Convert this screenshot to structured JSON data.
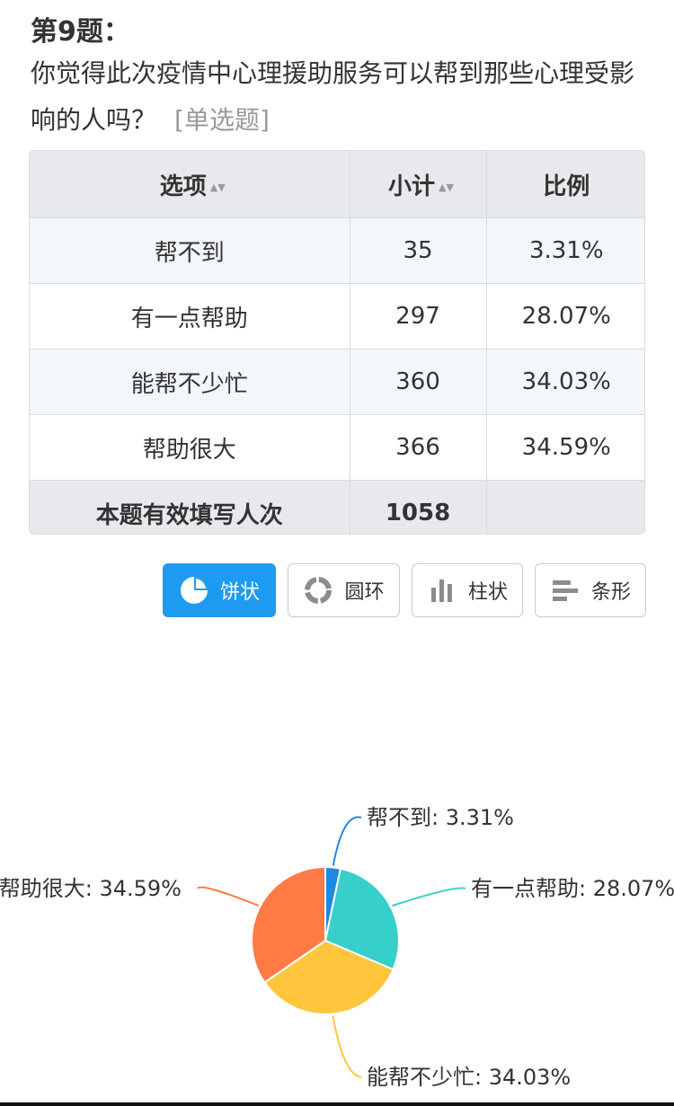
{
  "question": {
    "number": "第9题：",
    "text": "你觉得此次疫情中心理援助服务可以帮到那些心理受影响的人吗？",
    "type": "[单选题]"
  },
  "table": {
    "headers": [
      "选项",
      "小计",
      "比例"
    ],
    "rows": [
      {
        "option": "帮不到",
        "count": "35",
        "ratio": "3.31%"
      },
      {
        "option": "有一点帮助",
        "count": "297",
        "ratio": "28.07%"
      },
      {
        "option": "能帮不少忙",
        "count": "360",
        "ratio": "34.03%"
      },
      {
        "option": "帮助很大",
        "count": "366",
        "ratio": "34.59%"
      }
    ],
    "total_label": "本题有效填写人次",
    "total_value": "1058",
    "total_ratio": ""
  },
  "chart_buttons": [
    {
      "label": "饼状",
      "icon": "pie-chart-icon",
      "active": true
    },
    {
      "label": "圆环",
      "icon": "donut-chart-icon",
      "active": false
    },
    {
      "label": "柱状",
      "icon": "bar-chart-icon",
      "active": false
    },
    {
      "label": "条形",
      "icon": "horizontal-bar-chart-icon",
      "active": false
    }
  ],
  "chart_data": {
    "type": "pie",
    "categories": [
      "帮不到",
      "有一点帮助",
      "能帮不少忙",
      "帮助很大"
    ],
    "values": [
      35,
      297,
      360,
      366
    ],
    "percents": [
      3.31,
      28.07,
      34.03,
      34.59
    ],
    "labels": [
      "帮不到: 3.31%",
      "有一点帮助: 28.07%",
      "能帮不少忙: 34.03%",
      "帮助很大: 34.59%"
    ],
    "colors": [
      "#1e88e5",
      "#36cfc9",
      "#ffc53d",
      "#ff7a45"
    ]
  }
}
